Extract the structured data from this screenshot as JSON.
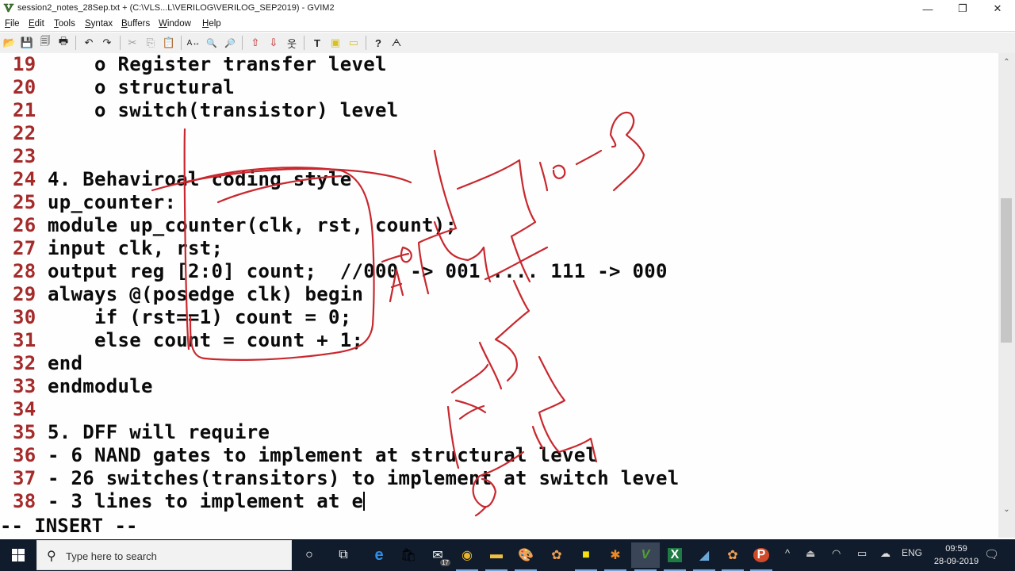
{
  "window": {
    "title": "session2_notes_28Sep.txt + (C:\\VLS...L\\VERILOG\\VERILOG_SEP2019) - GVIM2",
    "app_icon": "vim-icon",
    "controls": [
      {
        "name": "minimize",
        "glyph": "—"
      },
      {
        "name": "restore",
        "glyph": "❐"
      },
      {
        "name": "close",
        "glyph": "✕"
      }
    ]
  },
  "menubar": {
    "items": [
      {
        "label": "File",
        "accel": "F",
        "rest": "ile"
      },
      {
        "label": "Edit",
        "accel": "E",
        "rest": "dit"
      },
      {
        "label": "Tools",
        "accel": "T",
        "rest": "ools"
      },
      {
        "label": "Syntax",
        "accel": "S",
        "rest": "yntax"
      },
      {
        "label": "Buffers",
        "accel": "B",
        "rest": "uffers"
      },
      {
        "label": "Window",
        "accel": "W",
        "rest": "indow"
      },
      {
        "label": "Help",
        "accel": "H",
        "rest": "elp"
      }
    ]
  },
  "toolbar": {
    "buttons": [
      {
        "name": "open",
        "glyph": "📂"
      },
      {
        "name": "save",
        "glyph": "💾"
      },
      {
        "name": "save-all",
        "glyph": "🗐"
      },
      {
        "name": "print",
        "glyph": "🖶"
      },
      {
        "name": "undo",
        "glyph": "↶"
      },
      {
        "name": "redo",
        "glyph": "↷"
      },
      {
        "name": "cut",
        "glyph": "✂"
      },
      {
        "name": "copy",
        "glyph": "⎘"
      },
      {
        "name": "paste",
        "glyph": "📋"
      },
      {
        "name": "find-replace",
        "glyph": "A↔"
      },
      {
        "name": "find-next",
        "glyph": "🔍"
      },
      {
        "name": "find-prev",
        "glyph": "🔎"
      },
      {
        "name": "load-session",
        "glyph": "⇧"
      },
      {
        "name": "save-session",
        "glyph": "⇩"
      },
      {
        "name": "run-script",
        "glyph": "웃"
      },
      {
        "name": "make",
        "glyph": "T"
      },
      {
        "name": "shell",
        "glyph": "▣"
      },
      {
        "name": "tags",
        "glyph": "▭"
      },
      {
        "name": "help",
        "glyph": "?"
      },
      {
        "name": "find-help",
        "glyph": "ᗅ"
      }
    ]
  },
  "editor": {
    "lines": [
      {
        "num": "19",
        "text": "    o Register transfer level"
      },
      {
        "num": "20",
        "text": "    o structural"
      },
      {
        "num": "21",
        "text": "    o switch(transistor) level"
      },
      {
        "num": "22",
        "text": ""
      },
      {
        "num": "23",
        "text": ""
      },
      {
        "num": "24",
        "text": "4. Behaviroal coding style"
      },
      {
        "num": "25",
        "text": "up_counter:"
      },
      {
        "num": "26",
        "text": "module up_counter(clk, rst, count);"
      },
      {
        "num": "27",
        "text": "input clk, rst;"
      },
      {
        "num": "28",
        "text": "output reg [2:0] count;  //000 -> 001 .... 111 -> 000"
      },
      {
        "num": "29",
        "text": "always @(posedge clk) begin"
      },
      {
        "num": "30",
        "text": "    if (rst==1) count = 0;"
      },
      {
        "num": "31",
        "text": "    else count = count + 1;"
      },
      {
        "num": "32",
        "text": "end"
      },
      {
        "num": "33",
        "text": "endmodule"
      },
      {
        "num": "34",
        "text": ""
      },
      {
        "num": "35",
        "text": "5. DFF will require"
      },
      {
        "num": "36",
        "text": "- 6 NAND gates to implement at structural level"
      },
      {
        "num": "37",
        "text": "- 26 switches(transitors) to implement at switch level"
      },
      {
        "num": "38",
        "text": "- 3 lines to implement at e"
      }
    ],
    "cursor_line": "38",
    "mode": "-- INSERT --",
    "annotation_color": "#c8282e"
  },
  "scrollbar": {
    "up_glyph": "⌃",
    "down_glyph": "⌄"
  },
  "taskbar": {
    "search_placeholder": "Type here to search",
    "apps": [
      {
        "name": "cortana",
        "glyph": "○",
        "color": "#ffffff"
      },
      {
        "name": "task-view",
        "glyph": "⧉",
        "color": "#ffffff"
      },
      {
        "name": "edge",
        "glyph": "e",
        "color": "#2f8fe8"
      },
      {
        "name": "store",
        "glyph": "🛍",
        "color": "#ffffff"
      },
      {
        "name": "mail",
        "glyph": "✉",
        "color": "#ffffff",
        "badge": "17"
      },
      {
        "name": "chrome",
        "glyph": "◉",
        "color": "#e8b428"
      },
      {
        "name": "file-explorer",
        "glyph": "▬",
        "color": "#f0c040"
      },
      {
        "name": "paint",
        "glyph": "🎨",
        "color": "#c0d0e8"
      },
      {
        "name": "app-orange-1",
        "glyph": "✿",
        "color": "#f0a050"
      },
      {
        "name": "sticky-notes",
        "glyph": "■",
        "color": "#f7e010"
      },
      {
        "name": "app-asterisk",
        "glyph": "✱",
        "color": "#f08a20"
      },
      {
        "name": "gvim",
        "glyph": "V",
        "color": "#50a030"
      },
      {
        "name": "excel",
        "glyph": "X",
        "color": "#1f7a44"
      },
      {
        "name": "app-blue",
        "glyph": "◢",
        "color": "#6aa8d8"
      },
      {
        "name": "app-orange-2",
        "glyph": "✿",
        "color": "#f0a050"
      },
      {
        "name": "powerpoint",
        "glyph": "P",
        "color": "#d04a2a"
      }
    ],
    "tray": {
      "chevron": "^",
      "language": "ENG",
      "time": "09:59",
      "date": "28-09-2019"
    }
  }
}
